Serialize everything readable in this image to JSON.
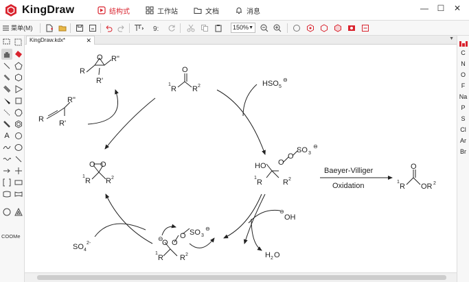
{
  "app": {
    "name": "KingDraw",
    "brand_color": "#d9232e"
  },
  "nav": [
    {
      "label": "结构式",
      "icon": "structure-icon"
    },
    {
      "label": "工作站",
      "icon": "grid-icon"
    },
    {
      "label": "文档",
      "icon": "folder-icon"
    },
    {
      "label": "消息",
      "icon": "bell-icon"
    }
  ],
  "window": {
    "minimize": "—",
    "restore": "☐",
    "close": "✕"
  },
  "toolbar": {
    "menu_label": "菜单(M)",
    "zoom": "150%"
  },
  "left_tools": {
    "text_tool": "A",
    "coome": "COOMe"
  },
  "tab": {
    "name": "KingDraw.kdx*",
    "close": "✕"
  },
  "elements": [
    "C",
    "N",
    "O",
    "F",
    "Na",
    "P",
    "S",
    "Cl",
    "Ar",
    "Br"
  ],
  "reaction": {
    "ketone": {
      "r1": "1",
      "r2": "2",
      "letter": "R",
      "o": "O"
    },
    "reagent": {
      "formula": "HSO",
      "sub": "5",
      "charge": "⊖"
    },
    "criegee": {
      "ho": "HO",
      "o1": "O",
      "o2": "O",
      "so3": "SO",
      "sub": "3",
      "charge": "⊖"
    },
    "arrow": {
      "top": "Baeyer-Villiger",
      "bottom": "Oxidation"
    },
    "ester": {
      "o": "O",
      "or": "OR",
      "sup": "2"
    },
    "hydroxide": {
      "charge": "⊖",
      "label": "OH"
    },
    "water": {
      "h": "H",
      "sub": "2",
      "o": "O"
    },
    "anion": {
      "charge": "⊖",
      "so3": "SO",
      "sub": "3",
      "charge2": "⊖"
    },
    "sulfate": {
      "so": "SO",
      "sub": "4",
      "sup": "2-"
    },
    "dioxirane": {
      "o": "O"
    },
    "epoxide": {
      "r": "R",
      "r2": "R\"",
      "r1": "R'",
      "o": "O"
    },
    "alkene": {
      "r": "R",
      "r2": "R\"",
      "r1": "R'"
    }
  }
}
